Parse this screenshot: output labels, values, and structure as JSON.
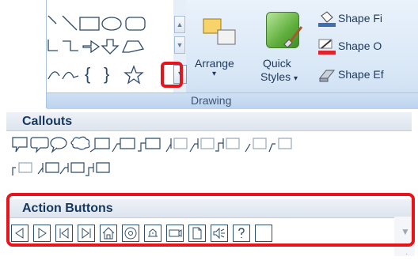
{
  "ribbon": {
    "arrange_label": "Arrange",
    "quick_label": "Quick",
    "styles_label": "Styles",
    "shape_fill_label": "Shape Fi",
    "shape_outline_label": "Shape O",
    "shape_effects_label": "Shape Ef",
    "group_label": "Drawing"
  },
  "panel": {
    "callouts_header": "Callouts",
    "action_buttons_header": "Action Buttons"
  },
  "colors": {
    "highlight": "#e8141c",
    "ribbon_bg": "#d7e6f6",
    "header_text": "#15375e"
  }
}
